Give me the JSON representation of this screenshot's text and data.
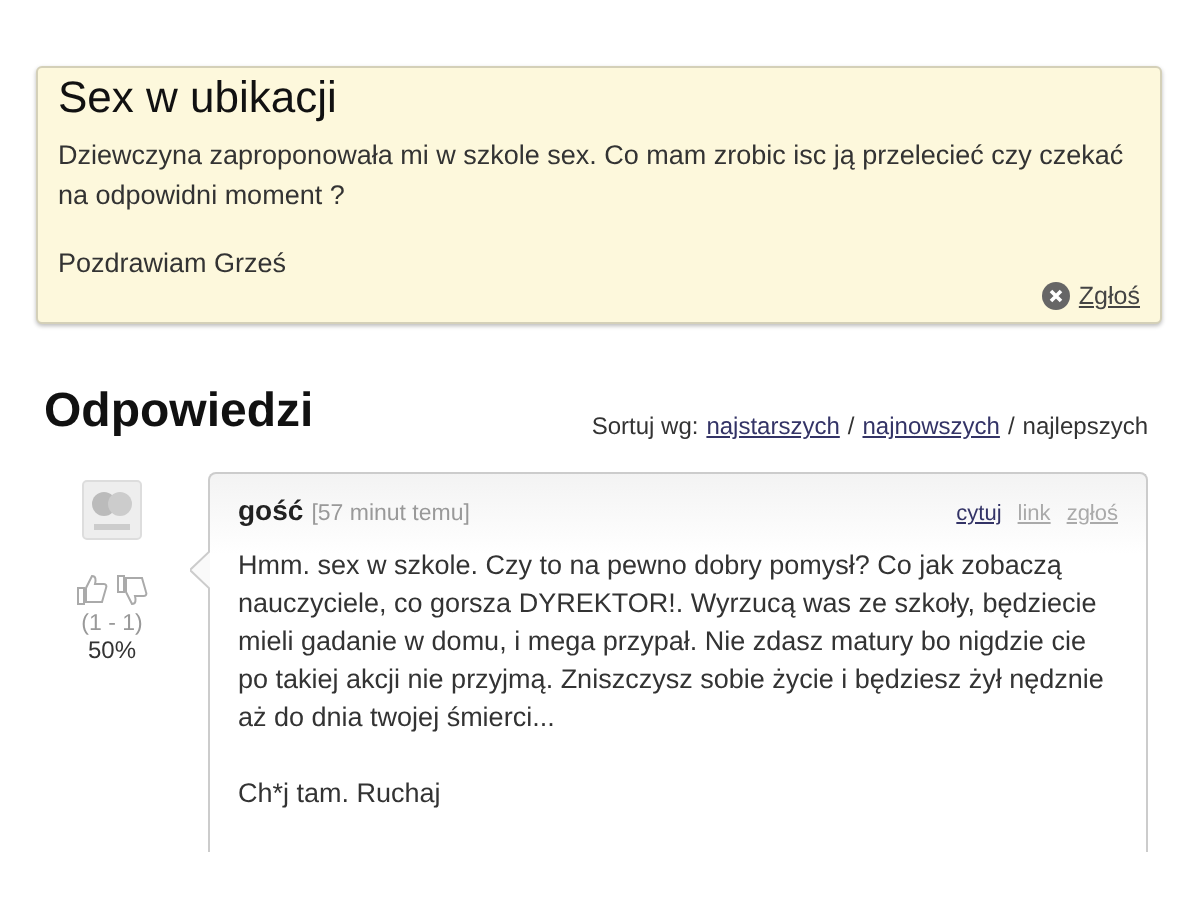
{
  "question": {
    "title": "Sex w ubikacji",
    "body": "Dziewczyna zaproponowała mi w szkole sex. Co mam zrobic isc ją przelecieć czy czekać na odpowidni moment ?",
    "signature": "Pozdrawiam Grześ",
    "report_link": "Zgłoś"
  },
  "answers_heading": "Odpowiedzi",
  "sort": {
    "label": "Sortuj wg:",
    "options": [
      {
        "label": "najstarszych",
        "selected": false
      },
      {
        "label": "najnowszych",
        "selected": false
      },
      {
        "label": "najlepszych",
        "selected": true
      }
    ],
    "separator": "/"
  },
  "comments": [
    {
      "author": "gość",
      "time": "[57 minut temu]",
      "actions": [
        {
          "label": "cytuj",
          "kind": "primary"
        },
        {
          "label": "link",
          "kind": "muted"
        },
        {
          "label": "zgłoś",
          "kind": "muted"
        }
      ],
      "votes": "(1 - 1)",
      "score": "50%",
      "paragraphs": [
        "Hmm. sex w szkole. Czy to na pewno dobry pomysł? Co jak zobaczą nauczyciele, co gorsza DYREKTOR!. Wyrzucą was ze szkoły, będziecie mieli gadanie w domu, i mega przypał. Nie zdasz matury bo nigdzie cie po takiej akcji nie przyjmą. Zniszczysz sobie życie i będziesz żył nędznie aż do dnia twojej śmierci...",
        "Ch*j tam. Ruchaj"
      ]
    }
  ]
}
